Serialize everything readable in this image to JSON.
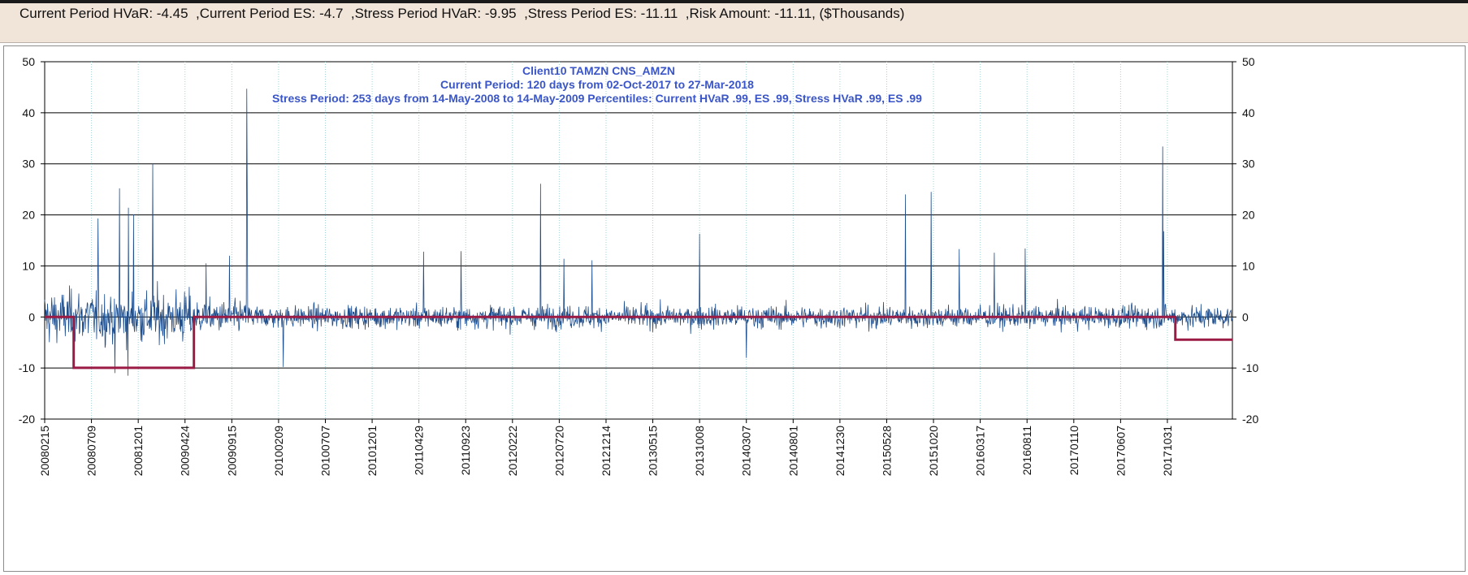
{
  "summary_text": "Current Period HVaR: -4.45  ,Current Period ES: -4.7  ,Stress Period HVaR: -9.95  ,Stress Period ES: -11.11  ,Risk Amount: -11.11, ($Thousands)",
  "colors": {
    "series": "#1f4e8c",
    "risk_line": "#9b1b45",
    "title_text": "#3a55c8",
    "topbar_bg": "#f1e4d9"
  },
  "chart_data": {
    "type": "line",
    "title_lines": [
      "Client10 TAMZN CNS_AMZN",
      "Current Period: 120 days from 02-Oct-2017 to 27-Mar-2018",
      "Stress Period: 253 days from 14-May-2008 to 14-May-2009  Percentiles:  Current HVaR .99,    ES .99,    Stress HVaR .99,    ES .99"
    ],
    "ylim": [
      -20,
      50
    ],
    "yticks": [
      -20,
      -10,
      0,
      10,
      20,
      30,
      40,
      50
    ],
    "grid": true,
    "x_tick_labels": [
      "20080215",
      "20080709",
      "20081201",
      "20090424",
      "20090915",
      "20100209",
      "20100707",
      "20101201",
      "20110429",
      "20110923",
      "20120222",
      "20120720",
      "20121214",
      "20130515",
      "20131008",
      "20140307",
      "20140801",
      "20141230",
      "20150528",
      "20151020",
      "20160317",
      "20160811",
      "20170110",
      "20170607",
      "20171031"
    ],
    "num_points": 2540,
    "x_tick_positions": [
      0,
      100,
      200,
      300,
      400,
      500,
      600,
      700,
      800,
      900,
      1000,
      1100,
      1200,
      1300,
      1400,
      1500,
      1600,
      1700,
      1800,
      1900,
      2000,
      2100,
      2200,
      2300,
      2400
    ],
    "spikes": [
      {
        "index": 432,
        "value": 44.7
      },
      {
        "index": 433,
        "value": 25
      },
      {
        "index": 231,
        "value": 30
      },
      {
        "index": 160,
        "value": 25.2
      },
      {
        "index": 179,
        "value": 21.4
      },
      {
        "index": 190,
        "value": 20.1
      },
      {
        "index": 114,
        "value": 19.3
      },
      {
        "index": 1060,
        "value": 26.1
      },
      {
        "index": 1840,
        "value": 24.0
      },
      {
        "index": 1895,
        "value": 24.5
      },
      {
        "index": 1400,
        "value": 16.3
      },
      {
        "index": 2390,
        "value": 33.4
      },
      {
        "index": 2392,
        "value": 16.8
      },
      {
        "index": 810,
        "value": 12.8
      },
      {
        "index": 890,
        "value": 12.9
      },
      {
        "index": 1955,
        "value": 13.3
      },
      {
        "index": 2030,
        "value": 12.6
      },
      {
        "index": 2096,
        "value": 13.4
      },
      {
        "index": 1110,
        "value": 11.4
      },
      {
        "index": 1170,
        "value": 11.1
      },
      {
        "index": 395,
        "value": 12.0
      },
      {
        "index": 345,
        "value": 10.5
      },
      {
        "index": 510,
        "value": -9.8
      },
      {
        "index": 178,
        "value": -11.5
      },
      {
        "index": 150,
        "value": -11.0
      },
      {
        "index": 1500,
        "value": -8.0
      }
    ],
    "risk_line": [
      {
        "index": 0,
        "value": 0
      },
      {
        "index": 62,
        "value": 0
      },
      {
        "index": 62,
        "value": -9.95
      },
      {
        "index": 319,
        "value": -9.95
      },
      {
        "index": 319,
        "value": 0
      },
      {
        "index": 2417,
        "value": 0
      },
      {
        "index": 2417,
        "value": -4.45
      },
      {
        "index": 2539,
        "value": -4.45
      }
    ]
  }
}
